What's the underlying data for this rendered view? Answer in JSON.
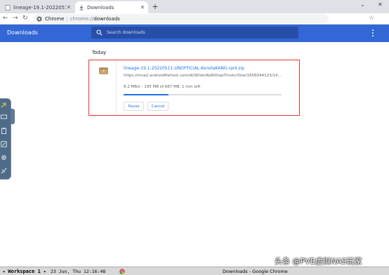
{
  "tabs": [
    {
      "label": "lineage-19.1-20220511-UN",
      "icon": "file-icon"
    },
    {
      "label": "Downloads",
      "icon": "download-icon"
    }
  ],
  "new_tab": "+",
  "window_controls": {
    "minimize": "⌄",
    "close": "✕"
  },
  "address": {
    "app_label": "Chrome",
    "url_scheme": "chrome://",
    "url_path": "downloads"
  },
  "header": {
    "title": "Downloads",
    "search_placeholder": "Search downloads",
    "accent": "#3367d6"
  },
  "section_label": "Today",
  "download": {
    "filename": "lineage-19.1-20220511-UNOFFICIAL-KonstaKANG-rpi4.zip",
    "url": "https://mva2.androidfilehost.com/dl/SKVonRzRtDopiTmotcr0ow/1656044123/1465534...",
    "status": "8.2 MB/s - 195 MB of 687 MB, 1 min left",
    "progress": 0.284,
    "pause_label": "Pause",
    "cancel_label": "Cancel"
  },
  "taskbar": {
    "workspace": "◂ Workspace 1 ▸",
    "clock": "23 Jun, Thu 12:16:48",
    "window_title": "Downloads - Google Chrome"
  },
  "watermark": "头条 @PVE虚拟NAS玩家"
}
